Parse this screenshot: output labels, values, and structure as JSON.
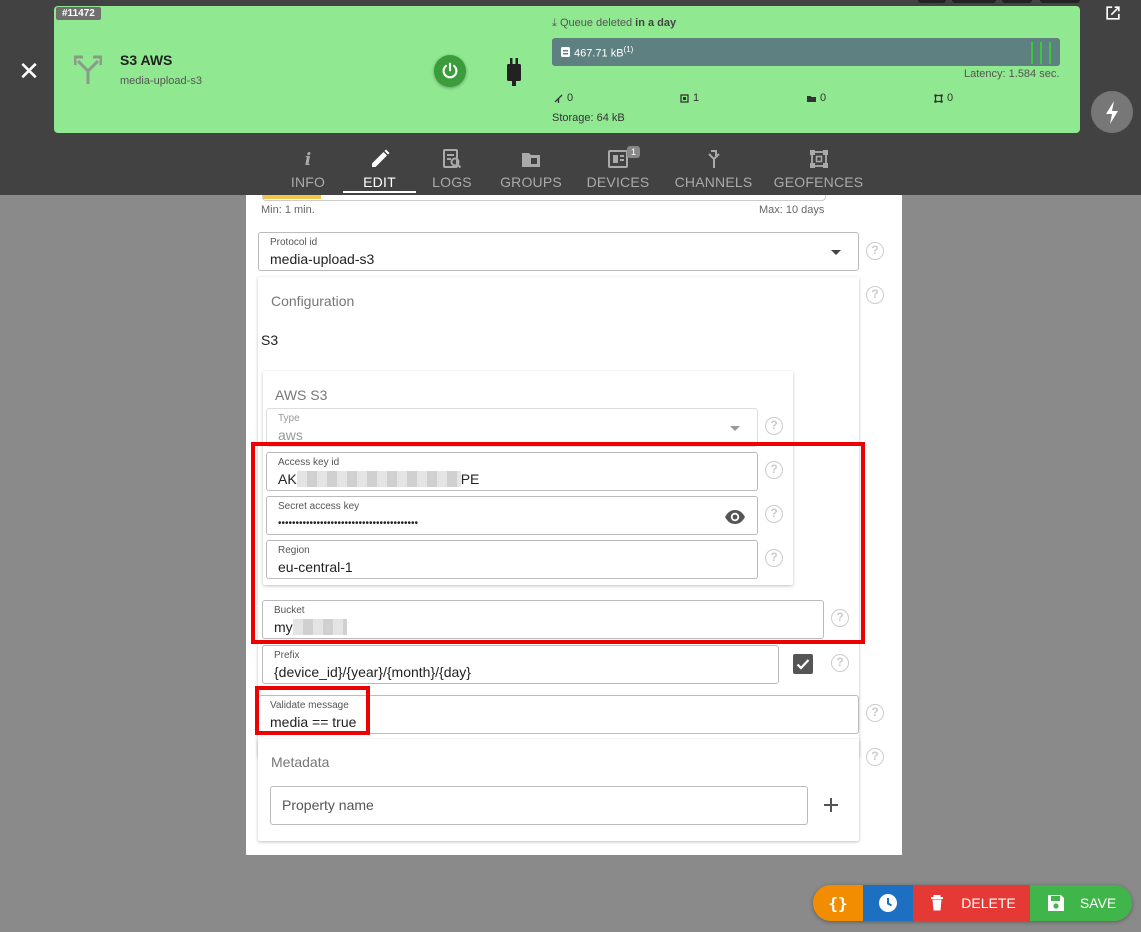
{
  "header": {
    "badge": "#11472",
    "title": "S3 AWS",
    "subtitle": "media-upload-s3",
    "queue_label_prefix": "Queue deleted",
    "queue_label_bold": "in a day",
    "queue_size": "467.71 kB",
    "queue_sup": "(1)",
    "latency": "Latency: 1.584 sec.",
    "stats": [
      "0",
      "1",
      "0",
      "0"
    ],
    "storage": "Storage: 64 kB",
    "card_color": "#90e890"
  },
  "tabs": [
    {
      "label": "INFO",
      "icon": "info-icon"
    },
    {
      "label": "EDIT",
      "icon": "pencil-icon",
      "active": true
    },
    {
      "label": "LOGS",
      "icon": "logs-icon"
    },
    {
      "label": "GROUPS",
      "icon": "groups-icon"
    },
    {
      "label": "DEVICES",
      "icon": "devices-icon",
      "badge": "1"
    },
    {
      "label": "CHANNELS",
      "icon": "channels-icon"
    },
    {
      "label": "GEOFENCES",
      "icon": "geofences-icon"
    }
  ],
  "form": {
    "ttl_min": "Min: 1 min.",
    "ttl_max": "Max: 10 days",
    "protocol": {
      "label": "Protocol id",
      "value": "media-upload-s3"
    },
    "configuration_title": "Configuration",
    "s3_label": "S3",
    "aws_title": "AWS S3",
    "type": {
      "label": "Type",
      "value": "aws"
    },
    "access_key": {
      "label": "Access key id",
      "prefix": "AK",
      "suffix": "PE"
    },
    "secret_key": {
      "label": "Secret access key",
      "value": "••••••••••••••••••••••••••••••••••••••••"
    },
    "region": {
      "label": "Region",
      "value": "eu-central-1"
    },
    "bucket": {
      "label": "Bucket",
      "prefix": "my"
    },
    "prefix": {
      "label": "Prefix",
      "value": "{device_id}/{year}/{month}/{day}"
    },
    "validate": {
      "label": "Validate message",
      "value": "media == true"
    },
    "metadata_title": "Metadata",
    "property_placeholder": "Property name",
    "help_glyph": "?"
  },
  "actions": {
    "json_label": "{}",
    "delete_label": "DELETE",
    "save_label": "SAVE"
  }
}
